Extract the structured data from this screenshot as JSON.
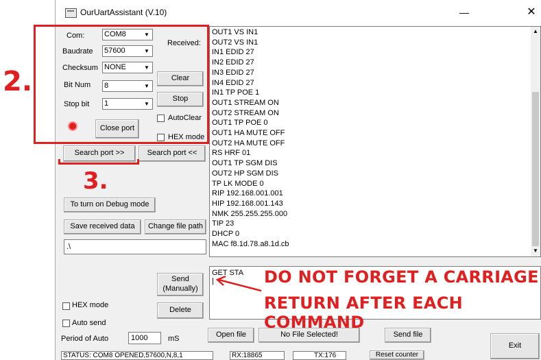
{
  "window": {
    "title": "OurUartAssistant (V.10)",
    "minimize": "—",
    "close": "✕"
  },
  "settings": {
    "com": {
      "label": "Com:",
      "value": "COM8"
    },
    "baudrate": {
      "label": "Baudrate",
      "value": "57600"
    },
    "checksum": {
      "label": "Checksum",
      "value": "NONE"
    },
    "bitnum": {
      "label": "Bit Num",
      "value": "8"
    },
    "stopbit": {
      "label": "Stop bit",
      "value": "1"
    },
    "close_port": "Close port",
    "search_port_fwd": "Search port >>",
    "search_port_back": "Search port <<"
  },
  "received": {
    "label": "Received:",
    "clear": "Clear",
    "stop": "Stop",
    "autoclear": "AutoClear",
    "hexmode": "HEX mode",
    "lines": [
      "OUT1 VS IN1",
      "OUT2 VS IN1",
      "IN1 EDID 27",
      "IN2 EDID 27",
      "IN3 EDID 27",
      "IN4 EDID 27",
      "IN1 TP POE 1",
      "OUT1 STREAM ON",
      "OUT2 STREAM ON",
      "OUT1 TP POE 0",
      "OUT1 HA MUTE OFF",
      "OUT2 HA MUTE OFF",
      "RS HRF 01",
      "OUT1 TP SGM DIS",
      "OUT2 HP SGM DIS",
      "TP LK MODE 0",
      "RIP 192.168.001.001",
      "HIP 192.168.001.143",
      "NMK 255.255.255.000",
      "TIP 23",
      "DHCP 0",
      "MAC f8.1d.78.a8.1d.cb"
    ]
  },
  "debug": {
    "label": "To turn on Debug mode"
  },
  "save": {
    "save_received": "Save received data",
    "change_path": "Change file path",
    "path": ".\\"
  },
  "send": {
    "text": "GET STA",
    "cursor": "|",
    "send_button": "Send (Manually)",
    "delete_button": "Delete",
    "hexmode": "HEX mode",
    "autosend": "Auto send",
    "period_label": "Period of Auto",
    "period_value": "1000",
    "period_unit": "mS",
    "open_file": "Open file",
    "file_status": "No File Selected!",
    "send_file": "Send file",
    "exit": "Exit"
  },
  "status": {
    "text": "STATUS: COM8 OPENED,57600,N,8,1",
    "rx": "RX:18865",
    "tx": "TX:176",
    "reset": "Reset counter"
  },
  "annotations": {
    "step2": "2.",
    "step3": "3.",
    "note_line1": "DO NOT FORGET A CARRIAGE",
    "note_line2": "RETURN AFTER EACH COMMAND",
    "color": "#e02020"
  }
}
